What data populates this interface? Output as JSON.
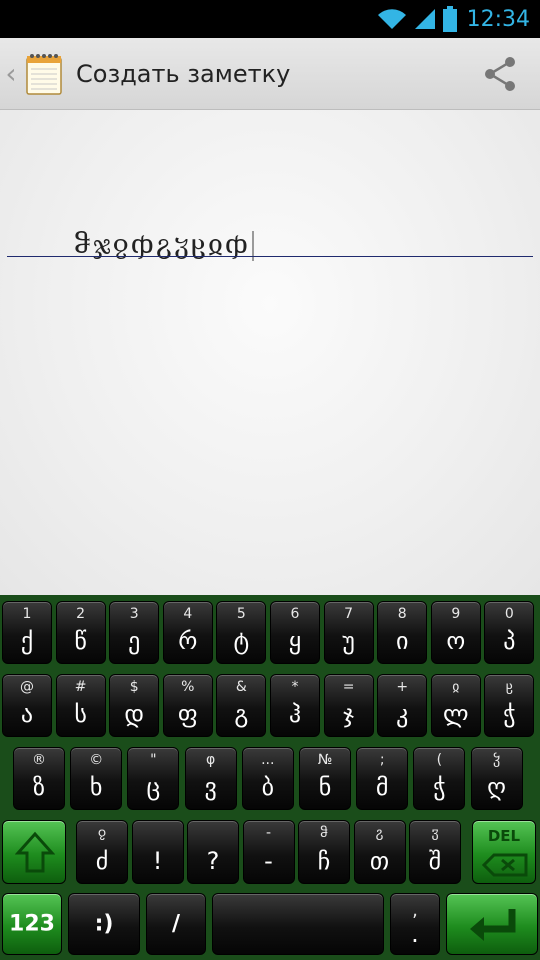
{
  "status_bar": {
    "time": "12:34"
  },
  "action_bar": {
    "title": "Создать заметку"
  },
  "note": {
    "text": "ჵჯჹჶჷჳჸჲჶ"
  },
  "keyboard": {
    "row1": [
      {
        "hint": "1",
        "char": "ქ"
      },
      {
        "hint": "2",
        "char": "წ"
      },
      {
        "hint": "3",
        "char": "ე"
      },
      {
        "hint": "4",
        "char": "რ"
      },
      {
        "hint": "5",
        "char": "ტ"
      },
      {
        "hint": "6",
        "char": "ყ"
      },
      {
        "hint": "7",
        "char": "უ"
      },
      {
        "hint": "8",
        "char": "ი"
      },
      {
        "hint": "9",
        "char": "ო"
      },
      {
        "hint": "0",
        "char": "პ"
      }
    ],
    "row2": [
      {
        "hint": "@",
        "char": "ა"
      },
      {
        "hint": "#",
        "char": "ს"
      },
      {
        "hint": "$",
        "char": "დ"
      },
      {
        "hint": "%",
        "char": "ფ"
      },
      {
        "hint": "&",
        "char": "გ"
      },
      {
        "hint": "*",
        "char": "ჰ"
      },
      {
        "hint": "=",
        "char": "ჯ"
      },
      {
        "hint": "+",
        "char": "კ"
      },
      {
        "hint": "ჲ",
        "char": "ლ"
      },
      {
        "hint": "ჸ",
        "char": "ჭ"
      }
    ],
    "row3": [
      {
        "hint": "®",
        "char": "ზ"
      },
      {
        "hint": "©",
        "char": "ხ"
      },
      {
        "hint": "\"",
        "char": "ც"
      },
      {
        "hint": "φ",
        "char": "ვ"
      },
      {
        "hint": "...",
        "char": "ბ"
      },
      {
        "hint": "№",
        "char": "ნ"
      },
      {
        "hint": ";",
        "char": "მ"
      },
      {
        "hint": "(",
        "char": "ჭ"
      },
      {
        "hint": "ჴ",
        "char": "ღ"
      }
    ],
    "row4": [
      {
        "hint": "ჹ",
        "char": "ძ"
      },
      {
        "hint": "",
        "char": "!"
      },
      {
        "hint": "",
        "char": "?"
      },
      {
        "hint": "-",
        "char": "-"
      },
      {
        "hint": "ჵ",
        "char": "ჩ"
      },
      {
        "hint": "ჷ",
        "char": "თ"
      },
      {
        "hint": "ჳ",
        "char": "შ"
      }
    ],
    "del_label": "DEL",
    "num_label": "123",
    "smiley_label": ":)",
    "slash_label": "/",
    "comma_label": ",",
    "period_label": "."
  }
}
